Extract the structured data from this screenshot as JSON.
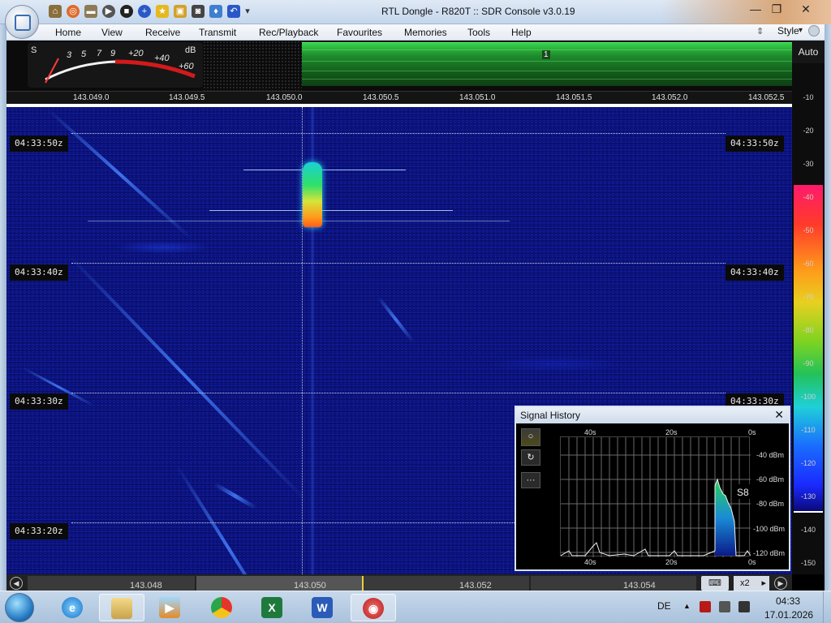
{
  "window": {
    "title": "RTL Dongle - R820T :: SDR Console v3.0.19",
    "minimize": "—",
    "maximize": "❐",
    "close": "✕"
  },
  "menu": {
    "items": [
      "Home",
      "View",
      "Receive",
      "Transmit",
      "Rec/Playback",
      "Favourites",
      "Memories",
      "Tools",
      "Help"
    ],
    "style_label": "Style"
  },
  "smeter": {
    "s_label": "S",
    "db_label": "dB",
    "scale": [
      "3",
      "5",
      "7",
      "9",
      "+20",
      "+40",
      "+60"
    ]
  },
  "spectrum": {
    "marker": "1"
  },
  "auto_button": "Auto",
  "db_scale": [
    "-10",
    "-20",
    "-30",
    "-40",
    "-50",
    "-60",
    "-70",
    "-80",
    "-90",
    "-100",
    "-110",
    "-120",
    "-130",
    "-140",
    "-150"
  ],
  "ruler": {
    "frequencies": [
      "143.049.0",
      "143.049.5",
      "143.050.0",
      "143.050.5",
      "143.051.0",
      "143.051.5",
      "143.052.0",
      "143.052.5"
    ]
  },
  "waterfall": {
    "timestamps": [
      "04:33:50z",
      "04:33:40z",
      "04:33:30z",
      "04:33:20z"
    ]
  },
  "signal_history": {
    "title": "Signal History",
    "close": "✕",
    "tools": [
      "○",
      "↻",
      "···"
    ],
    "time_top": [
      "40s",
      "20s",
      "0s"
    ],
    "time_bottom": [
      "40s",
      "20s",
      "0s"
    ],
    "levels": [
      "-40 dBm",
      "-60 dBm",
      "-80 dBm",
      "-100 dBm",
      "-120 dBm"
    ],
    "s_reading": "S8"
  },
  "scroller": {
    "frequencies": [
      "143.048",
      "143.050",
      "143.052",
      "143.054"
    ],
    "zoom": "x2",
    "zoom_arrow": "▸",
    "prev": "◀",
    "next": "▶"
  },
  "taskbar": {
    "language": "DE",
    "time": "04:33",
    "date": "17.01.2026",
    "tray_up": "▲"
  },
  "colors": {
    "waterfall_bg": "#0b137c",
    "spectrum_green": "#36d24b",
    "title_bar": "#dfe9f5"
  }
}
